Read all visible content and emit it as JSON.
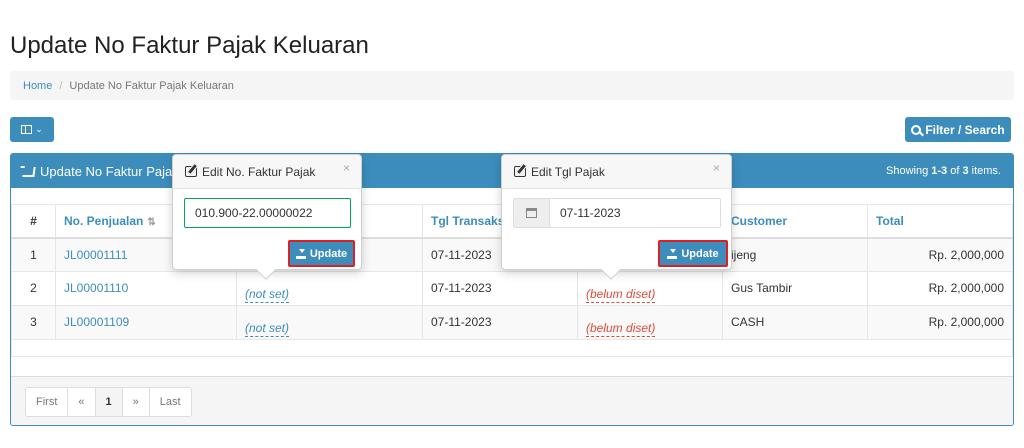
{
  "page": {
    "title": "Update No Faktur Pajak Keluaran"
  },
  "breadcrumb": {
    "home": "Home",
    "current": "Update No Faktur Pajak Keluaran"
  },
  "toolbar": {
    "filter_label": "Filter / Search"
  },
  "panel": {
    "title": "Update No Faktur Paja",
    "summary_prefix": "Showing ",
    "summary_range": "1-3",
    "summary_of": " of ",
    "summary_total": "3",
    "summary_suffix": " items."
  },
  "table": {
    "headers": {
      "num": "#",
      "no_penjualan": "No. Penjualan",
      "no_faktur": "",
      "tgl_transaksi": "Tgl Transaks",
      "tgl_pajak": "",
      "customer": "Customer",
      "total": "Total"
    },
    "rows": [
      {
        "num": "1",
        "no_penjualan": "JL00001111",
        "no_faktur": "",
        "tgl_transaksi": "07-11-2023",
        "tgl_pajak": "",
        "customer": "ijeng",
        "total": "Rp. 2,000,000"
      },
      {
        "num": "2",
        "no_penjualan": "JL00001110",
        "no_faktur": "(not set)",
        "tgl_transaksi": "07-11-2023",
        "tgl_pajak": "(belum diset)",
        "customer": "Gus Tambir",
        "total": "Rp. 2,000,000"
      },
      {
        "num": "3",
        "no_penjualan": "JL00001109",
        "no_faktur": "(not set)",
        "tgl_transaksi": "07-11-2023",
        "tgl_pajak": "(belum diset)",
        "customer": "CASH",
        "total": "Rp. 2,000,000"
      }
    ]
  },
  "pagination": {
    "first": "First",
    "prev": "«",
    "page": "1",
    "next": "»",
    "last": "Last"
  },
  "popover_faktur": {
    "title": "Edit No. Faktur Pajak",
    "close": "×",
    "value": "010.900-22.00000022",
    "update_label": "Update"
  },
  "popover_tgl": {
    "title": "Edit Tgl Pajak",
    "close": "×",
    "value": "07-11-2023",
    "update_label": "Update"
  },
  "colors": {
    "primary": "#3c8dbc",
    "highlight_border": "#e02020",
    "input_border": "#00a65a",
    "unset_warning": "#dd4b39"
  }
}
